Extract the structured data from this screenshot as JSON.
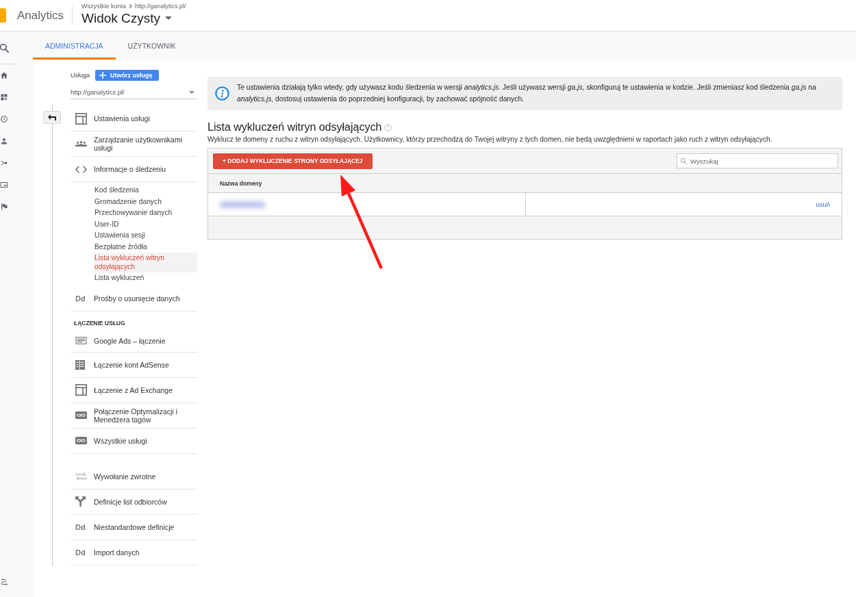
{
  "header": {
    "product": "Analytics",
    "breadcrumb": [
      "Wszystkie konta",
      "http://ganalytics.pl/"
    ],
    "view": "Widok Czysty"
  },
  "tabs": [
    {
      "label": "ADMINISTRACJA",
      "selected": true
    },
    {
      "label": "UŻYTKOWNIK",
      "selected": false
    }
  ],
  "sidebar": {
    "property_label": "Usługa",
    "create_button": "Utwórz usługę",
    "property_select": {
      "value": "http://ganalytics.pl/"
    },
    "groups": [
      {
        "items": [
          {
            "label": "Ustawienia usługi"
          },
          {
            "label": "Zarządzanie użytkownikami usługi"
          },
          {
            "label": "Informacje o śledzeniu",
            "children": [
              {
                "label": "Kod śledzenia",
                "selected": false
              },
              {
                "label": "Gromadzenie danych",
                "selected": false
              },
              {
                "label": "Przechowywanie danych",
                "selected": false
              },
              {
                "label": "User-ID",
                "selected": false
              },
              {
                "label": "Ustawienia sesji",
                "selected": false
              },
              {
                "label": "Bezpłatne źródła",
                "selected": false
              },
              {
                "label": "Lista wykluczeń witryn odsyłających",
                "selected": true
              },
              {
                "label": "Lista wykluczeń",
                "selected": false
              }
            ]
          },
          {
            "label": "Prośby o usunięcie danych",
            "icon_text": "Dd"
          }
        ]
      },
      {
        "heading": "ŁĄCZENIE USŁUG",
        "items": [
          {
            "label": "Google Ads – łączenie"
          },
          {
            "label": "Łączenie kont AdSense"
          },
          {
            "label": "Łączenie z Ad Exchange"
          },
          {
            "label": "Połączenie Optymalizacji i Menedżera tagów"
          },
          {
            "label": "Wszystkie usługi"
          }
        ]
      },
      {
        "items": [
          {
            "label": "Wywołanie zwrotne"
          },
          {
            "label": "Definicje list odbiorców"
          },
          {
            "label": "Niestandardowe definicje",
            "icon_text": "Dd"
          },
          {
            "label": "Import danych",
            "icon_text": "Dd"
          }
        ]
      }
    ]
  },
  "notice": {
    "text": "Te ustawienia działają tylko wtedy, gdy używasz kodu śledzenia w wersji *analytics.js*. Jeśli używasz wersji *ga.js*, skonfiguruj te ustawienia w kodzie. Jeśli zmieniasz kod śledzenia *ga.js* na *analytics.js*, dostosuj ustawienia do poprzedniej konfiguracji, by zachować spójność danych."
  },
  "section": {
    "title": "Lista wykluczeń witryn odsyłających",
    "description": "Wyklucz te domeny z ruchu z witryn odsyłających. Użytkownicy, którzy przechodzą do Twojej witryny z tych domen, nie będą uwzględnieni w raportach jako ruch z witryn odsyłających."
  },
  "table": {
    "add_button": "+ DODAJ WYKLUCZENIE STRONY ODSYŁAJĄCEJ",
    "search": {
      "placeholder": "Wyszukaj"
    },
    "columns": [
      {
        "label": "Nazwa domeny"
      }
    ],
    "rows": [
      {
        "redacted_domain": true,
        "action": "usuń"
      }
    ]
  }
}
